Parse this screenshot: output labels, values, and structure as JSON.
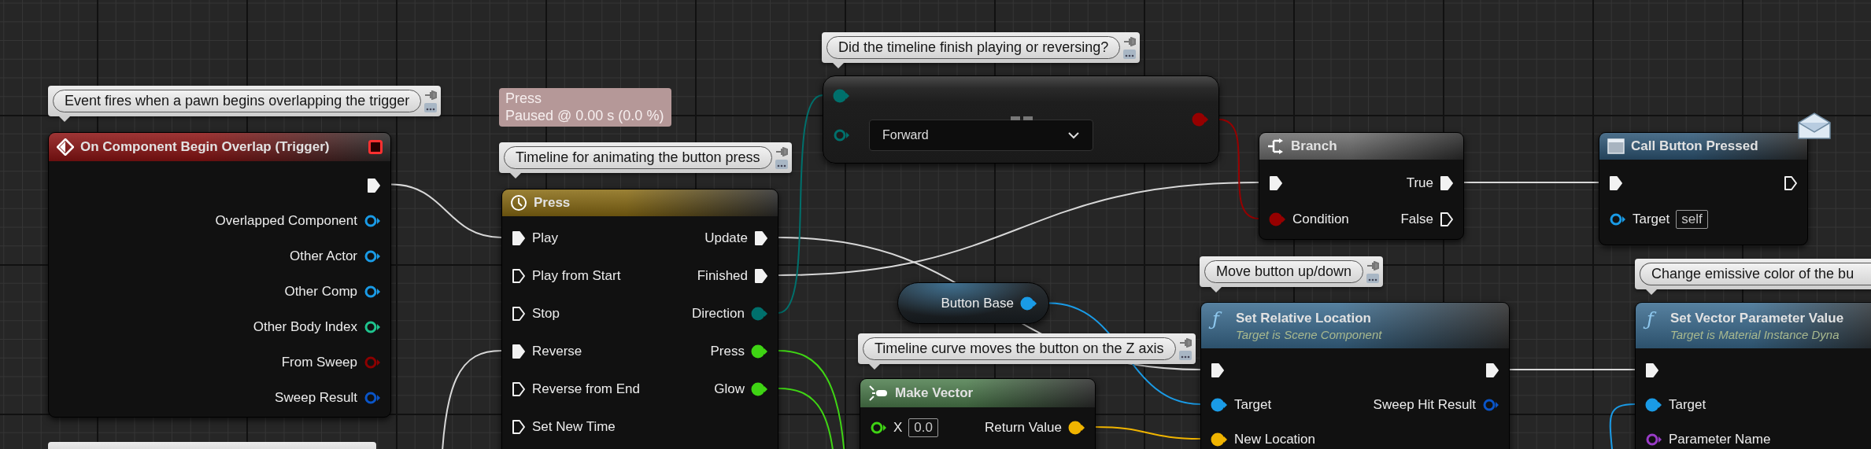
{
  "nodes": [
    {
      "kind": "event",
      "title": "On Component Begin Overlap (Trigger)",
      "comment": "Event fires when a pawn begins overlapping the trigger",
      "outputs": [
        {
          "kind": "exec",
          "connected": true
        },
        {
          "kind": "data",
          "label": "Overlapped Component",
          "color": "#1a9be6",
          "connected": false
        },
        {
          "kind": "data",
          "label": "Other Actor",
          "color": "#1a9be6",
          "connected": false
        },
        {
          "kind": "data",
          "label": "Other Comp",
          "color": "#1a9be6",
          "connected": false
        },
        {
          "kind": "data",
          "label": "Other Body Index",
          "color": "#1fc48e",
          "connected": false
        },
        {
          "kind": "data",
          "label": "From Sweep",
          "color": "#8c0000",
          "connected": false
        },
        {
          "kind": "data",
          "label": "Sweep Result",
          "color": "#0a55c8",
          "connected": false
        }
      ]
    },
    {
      "kind": "timeline",
      "title": "Press",
      "debug": {
        "name": "Press",
        "status": "Paused @ 0.00 s (0.0 %)"
      },
      "comment": "Timeline for animating the button press",
      "inputs": [
        {
          "kind": "exec",
          "label": "Play",
          "connected": true
        },
        {
          "kind": "exec",
          "label": "Play from Start",
          "connected": false
        },
        {
          "kind": "exec",
          "label": "Stop",
          "connected": false
        },
        {
          "kind": "exec",
          "label": "Reverse",
          "connected": true
        },
        {
          "kind": "exec",
          "label": "Reverse from End",
          "connected": false
        },
        {
          "kind": "exec",
          "label": "Set New Time",
          "connected": false
        }
      ],
      "outputs": [
        {
          "kind": "exec",
          "label": "Update",
          "connected": true
        },
        {
          "kind": "exec",
          "label": "Finished",
          "connected": true
        },
        {
          "kind": "data",
          "label": "Direction",
          "color": "#00706c",
          "connected": true
        },
        {
          "kind": "data",
          "label": "Press",
          "color": "#3fd414",
          "connected": true
        },
        {
          "kind": "data",
          "label": "Glow",
          "color": "#3fd414",
          "connected": true
        }
      ]
    },
    {
      "kind": "operator",
      "comment": "Did the timeline finish playing or reversing?",
      "inputs": [
        {
          "kind": "data",
          "color": "#00706c",
          "connected": true
        },
        {
          "kind": "data",
          "color": "#00706c",
          "connected": false,
          "value": {
            "kind": "dropdown",
            "text": "Forward"
          }
        }
      ],
      "outputs": [
        {
          "kind": "data",
          "color": "#960000",
          "connected": true
        }
      ]
    },
    {
      "kind": "branch",
      "title": "Branch",
      "inputs": [
        {
          "kind": "exec",
          "connected": true
        },
        {
          "kind": "data",
          "label": "Condition",
          "color": "#960000",
          "connected": true
        }
      ],
      "outputs": [
        {
          "kind": "exec",
          "label": "True",
          "connected": true
        },
        {
          "kind": "exec",
          "label": "False",
          "connected": false
        }
      ]
    },
    {
      "kind": "message",
      "title": "Call Button Pressed",
      "inputs": [
        {
          "kind": "exec",
          "connected": true
        },
        {
          "kind": "data",
          "label": "Target",
          "color": "#1a9be6",
          "connected": false,
          "value": {
            "kind": "text",
            "text": "self"
          }
        }
      ],
      "outputs": [
        {
          "kind": "exec",
          "connected": false
        }
      ]
    },
    {
      "kind": "variable",
      "outputs": [
        {
          "kind": "data",
          "label": "Button Base",
          "color": "#1a9be6",
          "connected": true
        }
      ]
    },
    {
      "kind": "function",
      "icon": "ƒ",
      "title": "Set Relative Location",
      "subtitle": "Target is Scene Component",
      "comment": "Move button up/down",
      "inputs": [
        {
          "kind": "exec",
          "connected": true
        },
        {
          "kind": "data",
          "label": "Target",
          "color": "#1a9be6",
          "connected": true
        },
        {
          "kind": "data",
          "label": "New Location",
          "color": "#f0b400",
          "connected": true
        }
      ],
      "outputs": [
        {
          "kind": "exec",
          "connected": true
        },
        {
          "kind": "data",
          "label": "Sweep Hit Result",
          "color": "#0a55c8",
          "connected": false
        }
      ]
    },
    {
      "kind": "make",
      "title": "Make Vector",
      "comment": "Timeline curve moves the button on the Z axis",
      "inputs": [
        {
          "kind": "data",
          "label": "X",
          "color": "#3fd414",
          "connected": false,
          "value": {
            "kind": "text",
            "text": "0.0"
          }
        }
      ],
      "outputs": [
        {
          "kind": "data",
          "label": "Return Value",
          "color": "#f0b400",
          "connected": true
        }
      ]
    },
    {
      "kind": "function",
      "icon": "ƒ",
      "title": "Set Vector Parameter Value",
      "subtitle": "Target is Material Instance Dyna",
      "comment": "Change emissive color of the bu",
      "inputs": [
        {
          "kind": "exec",
          "connected": true
        },
        {
          "kind": "data",
          "label": "Target",
          "color": "#1a9be6",
          "connected": true
        },
        {
          "kind": "data",
          "label": "Parameter Name",
          "color": "#9a3cc8",
          "connected": false
        }
      ]
    }
  ]
}
